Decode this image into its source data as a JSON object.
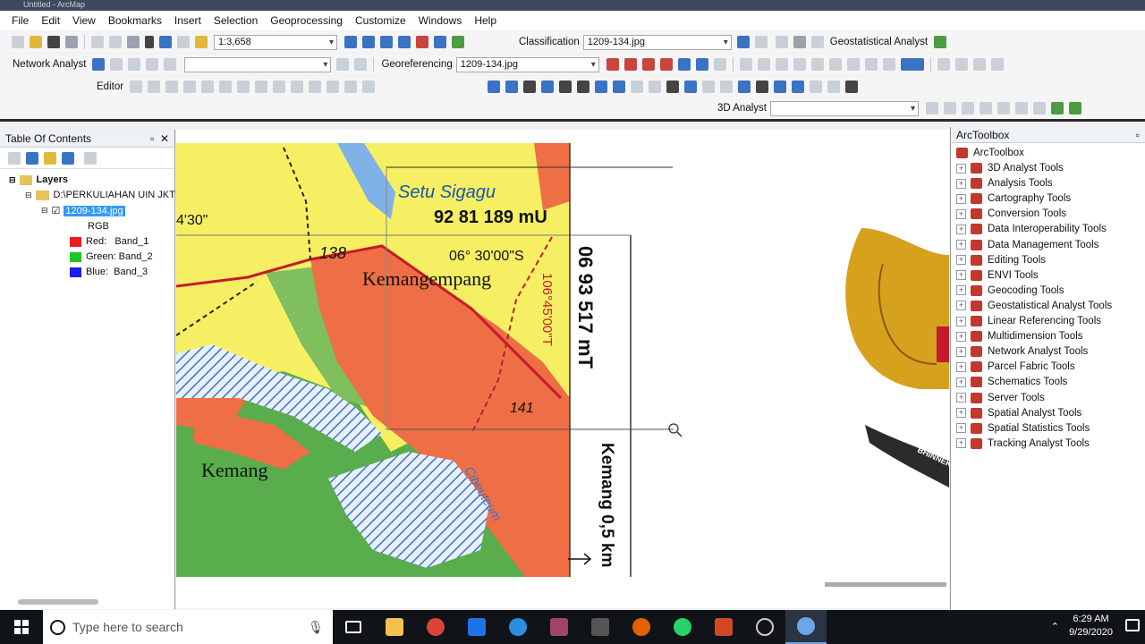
{
  "window": {
    "title": "Untitled - ArcMap"
  },
  "menu": [
    "File",
    "Edit",
    "View",
    "Bookmarks",
    "Insert",
    "Selection",
    "Geoprocessing",
    "Customize",
    "Windows",
    "Help"
  ],
  "toolbar1": {
    "scale": "1:3,658",
    "classification_label": "Classification",
    "layer_combo": "1209-134.jpg",
    "geostat_label": "Geostatistical Analyst"
  },
  "toolbar2": {
    "network_label": "Network Analyst",
    "georef_label": "Georeferencing",
    "georef_layer": "1209-134.jpg"
  },
  "toolbar3": {
    "editor_label": "Editor"
  },
  "toolbar4": {
    "analyst3d_label": "3D Analyst"
  },
  "toc": {
    "title": "Table Of Contents",
    "layers_label": "Layers",
    "folder_label": "D:\\PERKULIAHAN UIN JKT",
    "layer_name": "1209-134.jpg",
    "rgb_label": "RGB",
    "bands": [
      {
        "label": "Red:   Band_1",
        "color": "#ee1c1c"
      },
      {
        "label": "Green: Band_2",
        "color": "#22c422"
      },
      {
        "label": "Blue:  Band_3",
        "color": "#1c1cee"
      }
    ]
  },
  "map": {
    "label_lake": "Setu Sigagu",
    "label_coord_top": "92 81 189 mU",
    "label_lat": "06° 30'00\"S",
    "label_town1": "Kemangempang",
    "label_town2": "Kemang",
    "label_138": "138",
    "label_141": "141",
    "label_30": "4'30\"",
    "label_vert1": "06 93 517 mT",
    "label_vert2": "Kemang 0,5 km",
    "label_vert3": "106°45'00\"T",
    "label_river": "Cibeuteum",
    "emblem_text": "BHINNEKA"
  },
  "arctoolbox": {
    "title": "ArcToolbox",
    "root": "ArcToolbox",
    "items": [
      "3D Analyst Tools",
      "Analysis Tools",
      "Cartography Tools",
      "Conversion Tools",
      "Data Interoperability Tools",
      "Data Management Tools",
      "Editing Tools",
      "ENVI Tools",
      "Geocoding Tools",
      "Geostatistical Analyst Tools",
      "Linear Referencing Tools",
      "Multidimension Tools",
      "Network Analyst Tools",
      "Parcel Fabric Tools",
      "Schematics Tools",
      "Server Tools",
      "Spatial Analyst Tools",
      "Spatial Statistics Tools",
      "Tracking Analyst Tools"
    ]
  },
  "taskbar": {
    "search_placeholder": "Type here to search",
    "time": "6:29 AM",
    "date": "9/29/2020"
  }
}
